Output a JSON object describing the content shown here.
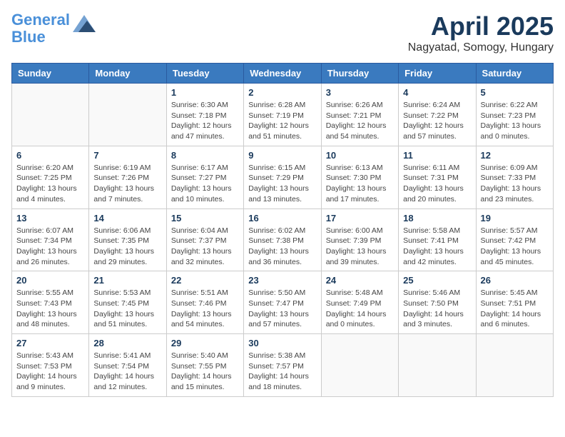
{
  "header": {
    "logo_line1": "General",
    "logo_line2": "Blue",
    "month_title": "April 2025",
    "location": "Nagyatad, Somogy, Hungary"
  },
  "weekdays": [
    "Sunday",
    "Monday",
    "Tuesday",
    "Wednesday",
    "Thursday",
    "Friday",
    "Saturday"
  ],
  "weeks": [
    [
      {
        "day": "",
        "info": ""
      },
      {
        "day": "",
        "info": ""
      },
      {
        "day": "1",
        "info": "Sunrise: 6:30 AM\nSunset: 7:18 PM\nDaylight: 12 hours and 47 minutes."
      },
      {
        "day": "2",
        "info": "Sunrise: 6:28 AM\nSunset: 7:19 PM\nDaylight: 12 hours and 51 minutes."
      },
      {
        "day": "3",
        "info": "Sunrise: 6:26 AM\nSunset: 7:21 PM\nDaylight: 12 hours and 54 minutes."
      },
      {
        "day": "4",
        "info": "Sunrise: 6:24 AM\nSunset: 7:22 PM\nDaylight: 12 hours and 57 minutes."
      },
      {
        "day": "5",
        "info": "Sunrise: 6:22 AM\nSunset: 7:23 PM\nDaylight: 13 hours and 0 minutes."
      }
    ],
    [
      {
        "day": "6",
        "info": "Sunrise: 6:20 AM\nSunset: 7:25 PM\nDaylight: 13 hours and 4 minutes."
      },
      {
        "day": "7",
        "info": "Sunrise: 6:19 AM\nSunset: 7:26 PM\nDaylight: 13 hours and 7 minutes."
      },
      {
        "day": "8",
        "info": "Sunrise: 6:17 AM\nSunset: 7:27 PM\nDaylight: 13 hours and 10 minutes."
      },
      {
        "day": "9",
        "info": "Sunrise: 6:15 AM\nSunset: 7:29 PM\nDaylight: 13 hours and 13 minutes."
      },
      {
        "day": "10",
        "info": "Sunrise: 6:13 AM\nSunset: 7:30 PM\nDaylight: 13 hours and 17 minutes."
      },
      {
        "day": "11",
        "info": "Sunrise: 6:11 AM\nSunset: 7:31 PM\nDaylight: 13 hours and 20 minutes."
      },
      {
        "day": "12",
        "info": "Sunrise: 6:09 AM\nSunset: 7:33 PM\nDaylight: 13 hours and 23 minutes."
      }
    ],
    [
      {
        "day": "13",
        "info": "Sunrise: 6:07 AM\nSunset: 7:34 PM\nDaylight: 13 hours and 26 minutes."
      },
      {
        "day": "14",
        "info": "Sunrise: 6:06 AM\nSunset: 7:35 PM\nDaylight: 13 hours and 29 minutes."
      },
      {
        "day": "15",
        "info": "Sunrise: 6:04 AM\nSunset: 7:37 PM\nDaylight: 13 hours and 32 minutes."
      },
      {
        "day": "16",
        "info": "Sunrise: 6:02 AM\nSunset: 7:38 PM\nDaylight: 13 hours and 36 minutes."
      },
      {
        "day": "17",
        "info": "Sunrise: 6:00 AM\nSunset: 7:39 PM\nDaylight: 13 hours and 39 minutes."
      },
      {
        "day": "18",
        "info": "Sunrise: 5:58 AM\nSunset: 7:41 PM\nDaylight: 13 hours and 42 minutes."
      },
      {
        "day": "19",
        "info": "Sunrise: 5:57 AM\nSunset: 7:42 PM\nDaylight: 13 hours and 45 minutes."
      }
    ],
    [
      {
        "day": "20",
        "info": "Sunrise: 5:55 AM\nSunset: 7:43 PM\nDaylight: 13 hours and 48 minutes."
      },
      {
        "day": "21",
        "info": "Sunrise: 5:53 AM\nSunset: 7:45 PM\nDaylight: 13 hours and 51 minutes."
      },
      {
        "day": "22",
        "info": "Sunrise: 5:51 AM\nSunset: 7:46 PM\nDaylight: 13 hours and 54 minutes."
      },
      {
        "day": "23",
        "info": "Sunrise: 5:50 AM\nSunset: 7:47 PM\nDaylight: 13 hours and 57 minutes."
      },
      {
        "day": "24",
        "info": "Sunrise: 5:48 AM\nSunset: 7:49 PM\nDaylight: 14 hours and 0 minutes."
      },
      {
        "day": "25",
        "info": "Sunrise: 5:46 AM\nSunset: 7:50 PM\nDaylight: 14 hours and 3 minutes."
      },
      {
        "day": "26",
        "info": "Sunrise: 5:45 AM\nSunset: 7:51 PM\nDaylight: 14 hours and 6 minutes."
      }
    ],
    [
      {
        "day": "27",
        "info": "Sunrise: 5:43 AM\nSunset: 7:53 PM\nDaylight: 14 hours and 9 minutes."
      },
      {
        "day": "28",
        "info": "Sunrise: 5:41 AM\nSunset: 7:54 PM\nDaylight: 14 hours and 12 minutes."
      },
      {
        "day": "29",
        "info": "Sunrise: 5:40 AM\nSunset: 7:55 PM\nDaylight: 14 hours and 15 minutes."
      },
      {
        "day": "30",
        "info": "Sunrise: 5:38 AM\nSunset: 7:57 PM\nDaylight: 14 hours and 18 minutes."
      },
      {
        "day": "",
        "info": ""
      },
      {
        "day": "",
        "info": ""
      },
      {
        "day": "",
        "info": ""
      }
    ]
  ]
}
